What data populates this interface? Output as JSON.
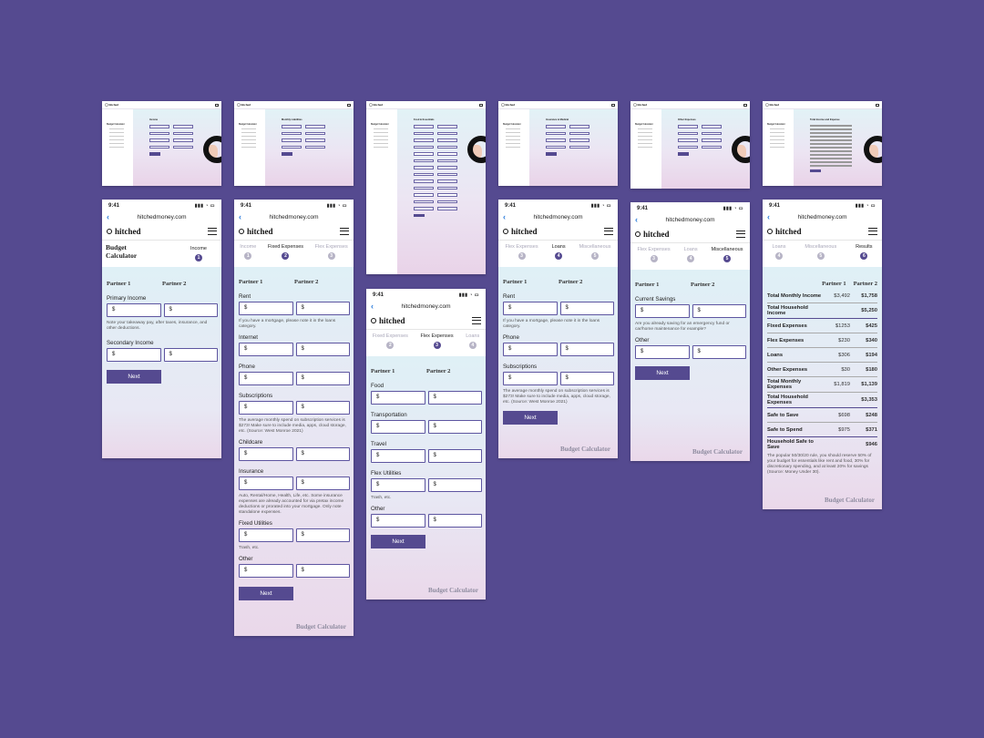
{
  "desktop": [
    {
      "heading": "Income",
      "steps": 6
    },
    {
      "heading": "Monthly Liabilities",
      "steps": 6
    },
    {
      "heading": "Food & Essentials",
      "steps": 6
    },
    {
      "heading": "Insurance & Medical",
      "steps": 6
    },
    {
      "heading": "Other Expenses",
      "steps": 6
    },
    {
      "heading": "Total Income and Expense",
      "steps": 6
    }
  ],
  "status": {
    "time": "9:41",
    "signal": "▮▮▮ ◔ ▭"
  },
  "browser": {
    "url": "hitchedmoney.com"
  },
  "brand": "hitched",
  "app_title": "Budget Calculator",
  "partners": {
    "p1": "Partner 1",
    "p2": "Partner 2"
  },
  "currency": "$",
  "next": "Next",
  "footer": "Budget Calculator",
  "phone1": {
    "steps": [
      {
        "label": "Income",
        "num": "1"
      }
    ],
    "primary": "Primary Income",
    "primary_note": "Note your takeaway pay, after taxes, insurance, and other deductions.",
    "secondary": "Secondary Income"
  },
  "phone2": {
    "steps": [
      {
        "label": "Income",
        "num": "1"
      },
      {
        "label": "Fixed Expenses",
        "num": "2"
      },
      {
        "label": "Flex Expenses",
        "num": "3"
      }
    ],
    "rent": "Rent",
    "rent_note": "If you have a mortgage, please note it in the loans category.",
    "internet": "Internet",
    "phone": "Phone",
    "subs": "Subscriptions",
    "subs_note": "The average monthly spend on subscription services is $273! Make sure to include media, apps, cloud storage, etc. (Source: West Monroe 2021)",
    "childcare": "Childcare",
    "insurance": "Insurance",
    "ins_note": "Auto, Rental/Home, Health, Life, etc. Some insurance expenses are already accounted for via pretax income deductions or prorated into your mortgage. Only note standalone expenses.",
    "utilities": "Fixed Utilities",
    "util_note": "Trash, etc.",
    "other": "Other"
  },
  "phone3": {
    "steps": [
      {
        "label": "Fixed Expenses",
        "num": "2"
      },
      {
        "label": "Flex Expenses",
        "num": "3"
      },
      {
        "label": "Loans",
        "num": "4"
      }
    ],
    "food": "Food",
    "transport": "Transportation",
    "travel": "Travel",
    "flexutil": "Flex Utilities",
    "flex_note": "Trash, etc.",
    "other": "Other"
  },
  "phone4": {
    "steps": [
      {
        "label": "Flex Expenses",
        "num": "3"
      },
      {
        "label": "Loans",
        "num": "4"
      },
      {
        "label": "Miscellaneous",
        "num": "5"
      }
    ],
    "rent": "Rent",
    "rent_note": "If you have a mortgage, please note it in the loans category.",
    "phone": "Phone",
    "subs": "Subscriptions",
    "subs_note": "The average monthly spend on subscription services is $273! Make sure to include media, apps, cloud storage, etc. (Source: West Monroe 2021)"
  },
  "phone5": {
    "steps": [
      {
        "label": "Flex Expenses",
        "num": "3"
      },
      {
        "label": "Loans",
        "num": "4"
      },
      {
        "label": "Miscellaneous",
        "num": "5"
      }
    ],
    "savings": "Current Savings",
    "savings_note": "Are you already saving for an emergency fund or car/home maintenance for example?",
    "other": "Other"
  },
  "phone6": {
    "steps": [
      {
        "label": "Loans",
        "num": "4"
      },
      {
        "label": "Miscellaneous",
        "num": "5"
      },
      {
        "label": "Results",
        "num": "6"
      }
    ],
    "rows": [
      {
        "k": "Total Monthly Income",
        "a": "$3,492",
        "b": "$1,758"
      },
      {
        "k": "Total Household Income",
        "a": "",
        "b": "$5,250"
      },
      {
        "k": "Fixed Expenses",
        "a": "$1253",
        "b": "$425"
      },
      {
        "k": "Flex Expenses",
        "a": "$230",
        "b": "$340"
      },
      {
        "k": "Loans",
        "a": "$306",
        "b": "$194"
      },
      {
        "k": "Other Expenses",
        "a": "$30",
        "b": "$180"
      },
      {
        "k": "Total Monthly Expenses",
        "a": "$1,819",
        "b": "$1,139"
      },
      {
        "k": "Total Household Expenses",
        "a": "",
        "b": "$3,353"
      },
      {
        "k": "Safe to Save",
        "a": "$698",
        "b": "$248"
      },
      {
        "k": "Safe to Spend",
        "a": "$975",
        "b": "$371"
      },
      {
        "k": "Household Safe to Save",
        "a": "",
        "b": "$946"
      }
    ],
    "note": "The popular 50/30/20 rule, you should reserve 50% of your budget for essentials like rent and food, 30% for discretionary spending, and at least 20% for savings (Source: Money Under 30)."
  }
}
